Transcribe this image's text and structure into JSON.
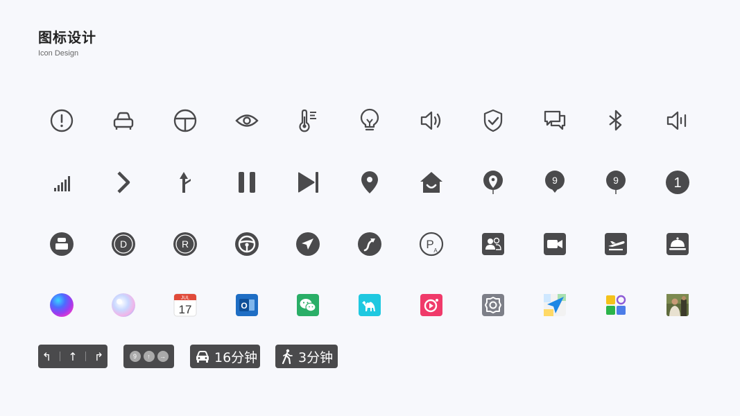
{
  "header": {
    "title": "图标设计",
    "subtitle": "Icon Design"
  },
  "colors": {
    "icon_dark": "#4a4a4c",
    "background": "#f7f8fc",
    "outlook_blue": "#1f6ec4",
    "wechat_green": "#2aae67",
    "camel_cyan": "#1fc8e0",
    "music_pink": "#f03a6a",
    "settings_gray": "#7d7f88",
    "calendar_red": "#e04a3a"
  },
  "row1_icons": [
    "alert-circle",
    "car-front",
    "steering-wheel",
    "eye",
    "thermometer",
    "light-bulb",
    "speaker-volume",
    "shield-check",
    "chat-bubbles",
    "bluetooth",
    "speaker-low"
  ],
  "row2_icons": [
    "signal-bars",
    "chevron-right",
    "road-fork-arrow",
    "pause",
    "skip-next",
    "map-pin",
    "home-smile",
    "location-pin",
    "pin-number-9",
    "pin-number-9-stem",
    "circle-number-1"
  ],
  "row3_icons": [
    "car-seat",
    "gear-d",
    "gear-r",
    "steering-wheel-filled",
    "navigation-arrow",
    "route",
    "parking-p-a",
    "contacts",
    "video-camera",
    "flight",
    "room-service"
  ],
  "row4_icons": [
    "gradient-orb",
    "bubble-orb",
    "calendar",
    "outlook",
    "wechat",
    "camel",
    "music-app",
    "settings-app",
    "maps-app",
    "app-grid",
    "photo-avatar"
  ],
  "pin_numbers": {
    "pin9a": "9",
    "pin9b": "9",
    "circle1": "1",
    "gear_d": "D",
    "gear_r": "R",
    "parking": "P",
    "parking_sub": "A"
  },
  "calendar": {
    "month": "JUL",
    "day": "17"
  },
  "outlook": {
    "letter": "O"
  },
  "badges": {
    "lane_arrows": [
      "↰",
      "↑",
      "↱"
    ],
    "dots": [
      "9",
      "↑",
      "→"
    ],
    "drive_time": "16分钟",
    "walk_time": "3分钟"
  }
}
